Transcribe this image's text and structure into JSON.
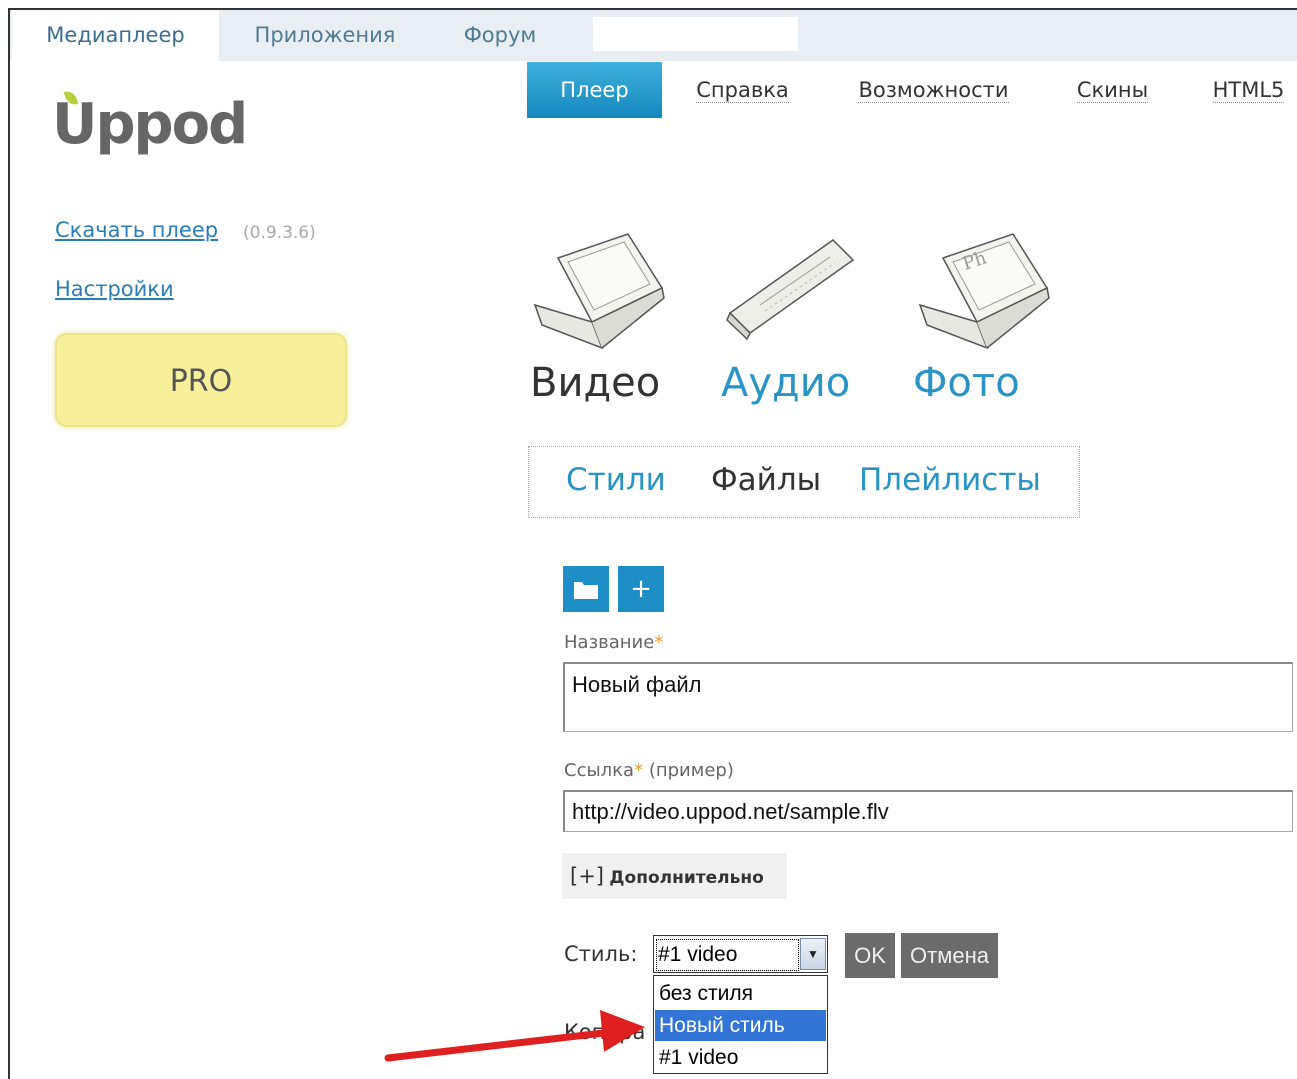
{
  "top_tabs": [
    {
      "label": "Медиаплеер"
    },
    {
      "label": "Приложения"
    },
    {
      "label": "Форум"
    }
  ],
  "logo": {
    "text": "Uppod"
  },
  "sidebar": {
    "download_link": "Скачать плеер",
    "version": "(0.9.3.6)",
    "settings_link": "Настройки",
    "pro_button": "PRO"
  },
  "nav": [
    {
      "label": "Плеер"
    },
    {
      "label": "Справка"
    },
    {
      "label": "Возможности"
    },
    {
      "label": "Скины"
    },
    {
      "label": "HTML5"
    }
  ],
  "media_types": [
    {
      "label": "Видео",
      "icon": "video-player-icon"
    },
    {
      "label": "Аудио",
      "icon": "audio-player-icon"
    },
    {
      "label": "Фото",
      "icon": "photo-player-icon"
    }
  ],
  "sub_tabs": [
    {
      "label": "Стили"
    },
    {
      "label": "Файлы"
    },
    {
      "label": "Плейлисты"
    }
  ],
  "toolbar": {
    "folder_icon": "folder-icon",
    "add_label": "+"
  },
  "form": {
    "name_label": "Название",
    "required_mark": "*",
    "name_value": "Новый  файл",
    "link_label": "Ссылка",
    "link_hint": "(пример)",
    "link_value": "http://video.uppod.net/sample.flv",
    "more_prefix": "[+]",
    "more_label": "Дополнительно",
    "style_label": "Стиль:",
    "style_selected": "#1 video",
    "ok_label": "OK",
    "cancel_label": "Отмена",
    "style_options": [
      "без стиля",
      "Новый стиль",
      "#1 video"
    ],
    "highlighted_option": "Новый стиль",
    "partial_label": "Копира"
  },
  "colors": {
    "accent": "#1e95c8",
    "arrow": "#e02020"
  }
}
